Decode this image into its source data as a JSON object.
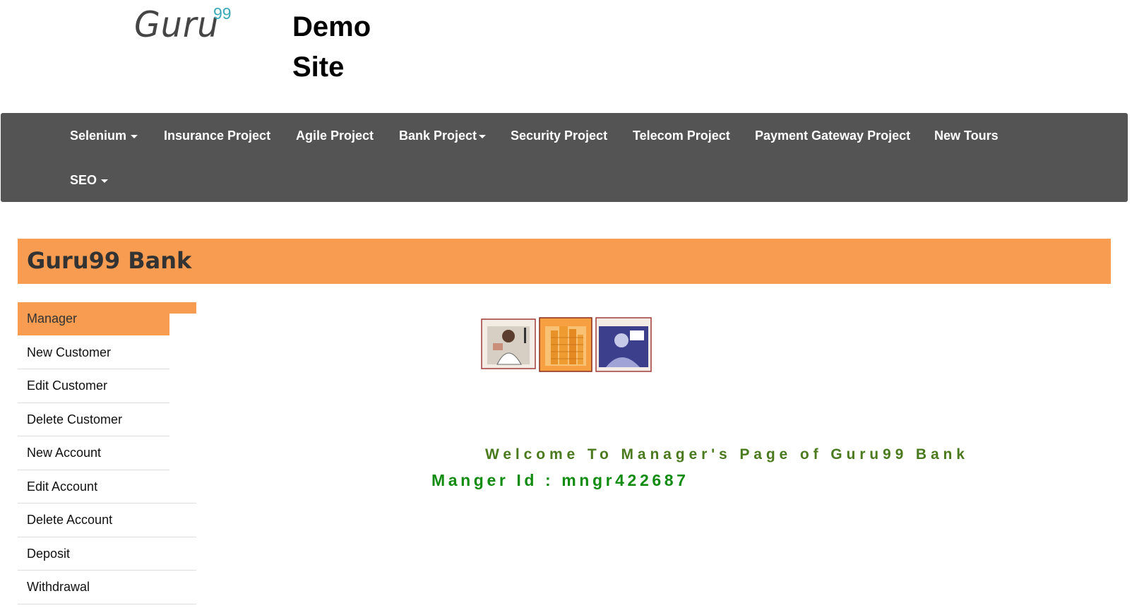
{
  "header": {
    "logo_text": "Guru",
    "logo_sup": "99",
    "site_title_line1": "Demo",
    "site_title_line2": "Site"
  },
  "navbar": {
    "items": [
      {
        "label": "Selenium",
        "dropdown": true
      },
      {
        "label": "Insurance Project",
        "dropdown": false
      },
      {
        "label": "Agile Project",
        "dropdown": false
      },
      {
        "label": "Bank Project",
        "dropdown": true
      },
      {
        "label": "Security Project",
        "dropdown": false
      },
      {
        "label": "Telecom Project",
        "dropdown": false
      },
      {
        "label": "Payment Gateway Project",
        "dropdown": false
      },
      {
        "label": "New Tours",
        "dropdown": false
      },
      {
        "label": "SEO",
        "dropdown": true
      }
    ]
  },
  "bank": {
    "title": "Guru99 Bank"
  },
  "sidebar": {
    "items": [
      {
        "label": "Manager",
        "active": true
      },
      {
        "label": "New Customer",
        "active": false
      },
      {
        "label": "Edit Customer",
        "active": false
      },
      {
        "label": "Delete Customer",
        "active": false
      },
      {
        "label": "New Account",
        "active": false
      },
      {
        "label": "Edit Account",
        "active": false
      },
      {
        "label": "Delete Account",
        "active": false
      },
      {
        "label": "Deposit",
        "active": false
      },
      {
        "label": "Withdrawal",
        "active": false
      }
    ]
  },
  "main": {
    "welcome_text": "Welcome To Manager's Page of Guru99 Bank",
    "manager_id_text": "Manger Id : mngr422687"
  },
  "colors": {
    "navbar_bg": "#545454",
    "accent_orange": "#f89c52",
    "welcome_green": "#4b7a1e",
    "manager_id_green": "#118c11",
    "logo_sup": "#3aa8b9"
  }
}
